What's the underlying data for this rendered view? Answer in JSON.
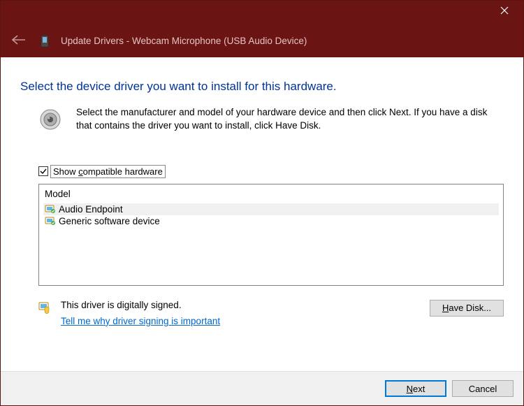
{
  "titlebar": {
    "close": "✕"
  },
  "header": {
    "title": "Update Drivers - Webcam Microphone (USB Audio Device)"
  },
  "main": {
    "heading": "Select the device driver you want to install for this hardware.",
    "info": "Select the manufacturer and model of your hardware device and then click Next. If you have a disk that contains the driver you want to install, click Have Disk.",
    "show_compatible_checked": true,
    "show_compatible_label": "Show compatible hardware",
    "list": {
      "header": "Model",
      "items": [
        {
          "label": "Audio Endpoint",
          "selected": true
        },
        {
          "label": "Generic software device",
          "selected": false
        }
      ]
    },
    "signed_text": "This driver is digitally signed.",
    "signed_link": "Tell me why driver signing is important",
    "have_disk": "Have Disk..."
  },
  "footer": {
    "next": "Next",
    "cancel": "Cancel"
  }
}
